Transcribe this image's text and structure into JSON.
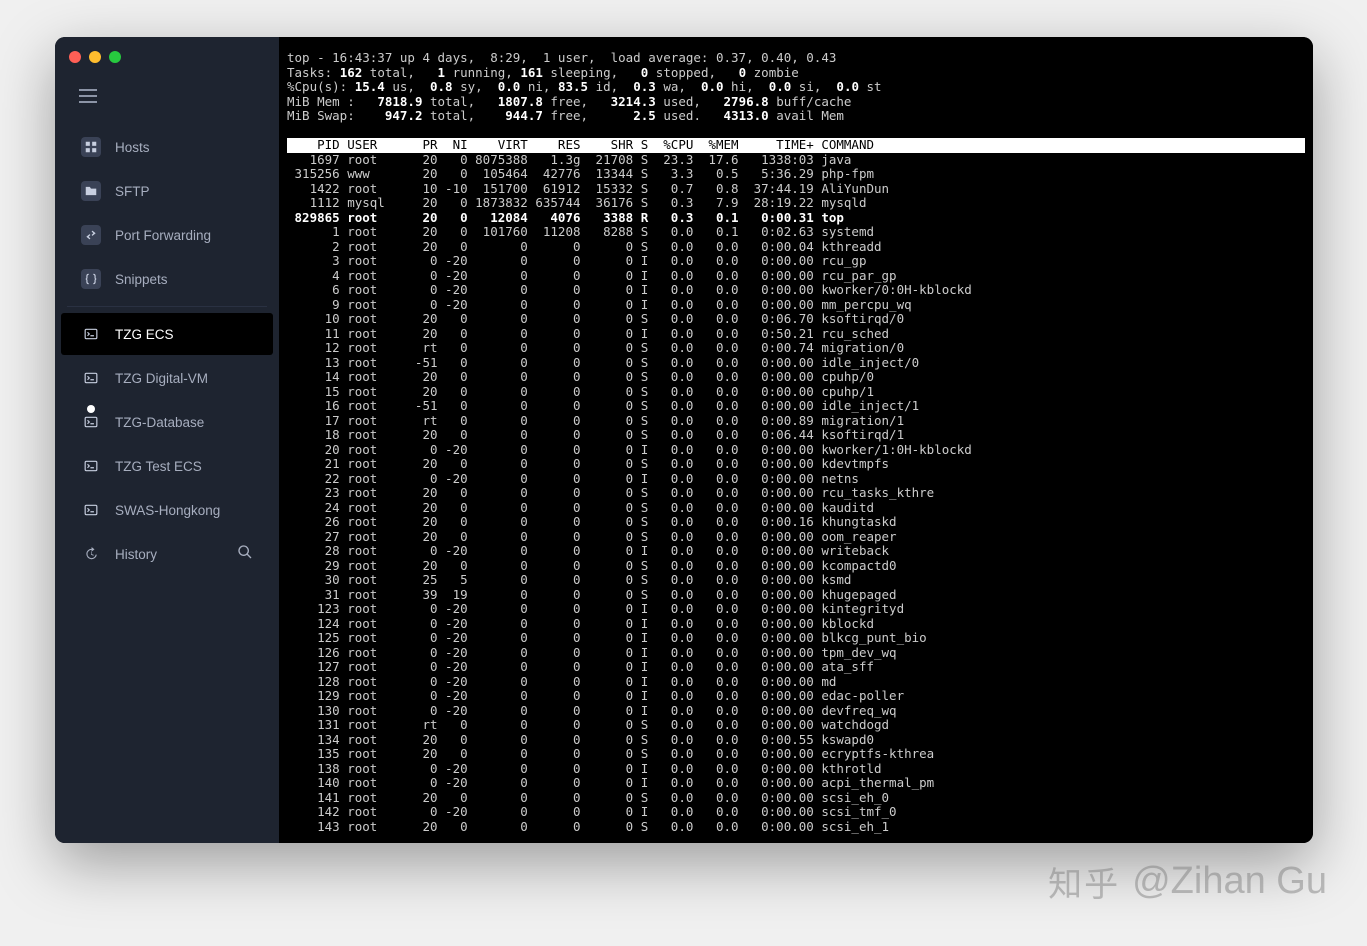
{
  "sidebar": {
    "items": [
      {
        "label": "Hosts",
        "icon": "grid"
      },
      {
        "label": "SFTP",
        "icon": "folder"
      },
      {
        "label": "Port Forwarding",
        "icon": "arrows"
      },
      {
        "label": "Snippets",
        "icon": "braces"
      },
      {
        "label": "TZG ECS",
        "icon": "term",
        "active": true
      },
      {
        "label": "TZG Digital-VM",
        "icon": "term"
      },
      {
        "label": "TZG-Database",
        "icon": "term",
        "dot": true
      },
      {
        "label": "TZG Test ECS",
        "icon": "term"
      },
      {
        "label": "SWAS-Hongkong",
        "icon": "term"
      }
    ],
    "history": "History"
  },
  "top": {
    "line1_a": "top - 16:43:37 up 4 days,  8:29,  1 user,  load average: 0.37, 0.40, 0.43",
    "tasks": {
      "total": "162",
      "running": "1",
      "sleeping": "161",
      "stopped": "0",
      "zombie": "0"
    },
    "cpu": {
      "us": "15.4",
      "sy": "0.8",
      "ni": "0.0",
      "id": "83.5",
      "wa": "0.3",
      "hi": "0.0",
      "si": "0.0",
      "st": "0.0"
    },
    "mem": {
      "total": "7818.9",
      "free": "1807.8",
      "used": "3214.3",
      "buff": "2796.8"
    },
    "swap": {
      "total": "947.2",
      "free": "944.7",
      "used": "2.5",
      "avail": "4313.0"
    },
    "header": "    PID USER      PR  NI    VIRT    RES    SHR S  %CPU  %MEM     TIME+ COMMAND",
    "rows": [
      [
        "   1697",
        "root",
        "20",
        "0",
        "8075388",
        "1.3g",
        "21708",
        "S",
        "23.3",
        "17.6",
        "1338:03",
        "java"
      ],
      [
        " 315256",
        "www",
        "20",
        "0",
        "105464",
        "42776",
        "13344",
        "S",
        "3.3",
        "0.5",
        "5:36.29",
        "php-fpm"
      ],
      [
        "   1422",
        "root",
        "10",
        "-10",
        "151700",
        "61912",
        "15332",
        "S",
        "0.7",
        "0.8",
        "37:44.19",
        "AliYunDun"
      ],
      [
        "   1112",
        "mysql",
        "20",
        "0",
        "1873832",
        "635744",
        "36176",
        "S",
        "0.3",
        "7.9",
        "28:19.22",
        "mysqld"
      ],
      [
        " 829865",
        "root",
        "20",
        "0",
        "12084",
        "4076",
        "3388",
        "R",
        "0.3",
        "0.1",
        "0:00.31",
        "top"
      ],
      [
        "      1",
        "root",
        "20",
        "0",
        "101760",
        "11208",
        "8288",
        "S",
        "0.0",
        "0.1",
        "0:02.63",
        "systemd"
      ],
      [
        "      2",
        "root",
        "20",
        "0",
        "0",
        "0",
        "0",
        "S",
        "0.0",
        "0.0",
        "0:00.04",
        "kthreadd"
      ],
      [
        "      3",
        "root",
        "0",
        "-20",
        "0",
        "0",
        "0",
        "I",
        "0.0",
        "0.0",
        "0:00.00",
        "rcu_gp"
      ],
      [
        "      4",
        "root",
        "0",
        "-20",
        "0",
        "0",
        "0",
        "I",
        "0.0",
        "0.0",
        "0:00.00",
        "rcu_par_gp"
      ],
      [
        "      6",
        "root",
        "0",
        "-20",
        "0",
        "0",
        "0",
        "I",
        "0.0",
        "0.0",
        "0:00.00",
        "kworker/0:0H-kblockd"
      ],
      [
        "      9",
        "root",
        "0",
        "-20",
        "0",
        "0",
        "0",
        "I",
        "0.0",
        "0.0",
        "0:00.00",
        "mm_percpu_wq"
      ],
      [
        "     10",
        "root",
        "20",
        "0",
        "0",
        "0",
        "0",
        "S",
        "0.0",
        "0.0",
        "0:06.70",
        "ksoftirqd/0"
      ],
      [
        "     11",
        "root",
        "20",
        "0",
        "0",
        "0",
        "0",
        "I",
        "0.0",
        "0.0",
        "0:50.21",
        "rcu_sched"
      ],
      [
        "     12",
        "root",
        "rt",
        "0",
        "0",
        "0",
        "0",
        "S",
        "0.0",
        "0.0",
        "0:00.74",
        "migration/0"
      ],
      [
        "     13",
        "root",
        "-51",
        "0",
        "0",
        "0",
        "0",
        "S",
        "0.0",
        "0.0",
        "0:00.00",
        "idle_inject/0"
      ],
      [
        "     14",
        "root",
        "20",
        "0",
        "0",
        "0",
        "0",
        "S",
        "0.0",
        "0.0",
        "0:00.00",
        "cpuhp/0"
      ],
      [
        "     15",
        "root",
        "20",
        "0",
        "0",
        "0",
        "0",
        "S",
        "0.0",
        "0.0",
        "0:00.00",
        "cpuhp/1"
      ],
      [
        "     16",
        "root",
        "-51",
        "0",
        "0",
        "0",
        "0",
        "S",
        "0.0",
        "0.0",
        "0:00.00",
        "idle_inject/1"
      ],
      [
        "     17",
        "root",
        "rt",
        "0",
        "0",
        "0",
        "0",
        "S",
        "0.0",
        "0.0",
        "0:00.89",
        "migration/1"
      ],
      [
        "     18",
        "root",
        "20",
        "0",
        "0",
        "0",
        "0",
        "S",
        "0.0",
        "0.0",
        "0:06.44",
        "ksoftirqd/1"
      ],
      [
        "     20",
        "root",
        "0",
        "-20",
        "0",
        "0",
        "0",
        "I",
        "0.0",
        "0.0",
        "0:00.00",
        "kworker/1:0H-kblockd"
      ],
      [
        "     21",
        "root",
        "20",
        "0",
        "0",
        "0",
        "0",
        "S",
        "0.0",
        "0.0",
        "0:00.00",
        "kdevtmpfs"
      ],
      [
        "     22",
        "root",
        "0",
        "-20",
        "0",
        "0",
        "0",
        "I",
        "0.0",
        "0.0",
        "0:00.00",
        "netns"
      ],
      [
        "     23",
        "root",
        "20",
        "0",
        "0",
        "0",
        "0",
        "S",
        "0.0",
        "0.0",
        "0:00.00",
        "rcu_tasks_kthre"
      ],
      [
        "     24",
        "root",
        "20",
        "0",
        "0",
        "0",
        "0",
        "S",
        "0.0",
        "0.0",
        "0:00.00",
        "kauditd"
      ],
      [
        "     26",
        "root",
        "20",
        "0",
        "0",
        "0",
        "0",
        "S",
        "0.0",
        "0.0",
        "0:00.16",
        "khungtaskd"
      ],
      [
        "     27",
        "root",
        "20",
        "0",
        "0",
        "0",
        "0",
        "S",
        "0.0",
        "0.0",
        "0:00.00",
        "oom_reaper"
      ],
      [
        "     28",
        "root",
        "0",
        "-20",
        "0",
        "0",
        "0",
        "I",
        "0.0",
        "0.0",
        "0:00.00",
        "writeback"
      ],
      [
        "     29",
        "root",
        "20",
        "0",
        "0",
        "0",
        "0",
        "S",
        "0.0",
        "0.0",
        "0:00.00",
        "kcompactd0"
      ],
      [
        "     30",
        "root",
        "25",
        "5",
        "0",
        "0",
        "0",
        "S",
        "0.0",
        "0.0",
        "0:00.00",
        "ksmd"
      ],
      [
        "     31",
        "root",
        "39",
        "19",
        "0",
        "0",
        "0",
        "S",
        "0.0",
        "0.0",
        "0:00.00",
        "khugepaged"
      ],
      [
        "    123",
        "root",
        "0",
        "-20",
        "0",
        "0",
        "0",
        "I",
        "0.0",
        "0.0",
        "0:00.00",
        "kintegrityd"
      ],
      [
        "    124",
        "root",
        "0",
        "-20",
        "0",
        "0",
        "0",
        "I",
        "0.0",
        "0.0",
        "0:00.00",
        "kblockd"
      ],
      [
        "    125",
        "root",
        "0",
        "-20",
        "0",
        "0",
        "0",
        "I",
        "0.0",
        "0.0",
        "0:00.00",
        "blkcg_punt_bio"
      ],
      [
        "    126",
        "root",
        "0",
        "-20",
        "0",
        "0",
        "0",
        "I",
        "0.0",
        "0.0",
        "0:00.00",
        "tpm_dev_wq"
      ],
      [
        "    127",
        "root",
        "0",
        "-20",
        "0",
        "0",
        "0",
        "I",
        "0.0",
        "0.0",
        "0:00.00",
        "ata_sff"
      ],
      [
        "    128",
        "root",
        "0",
        "-20",
        "0",
        "0",
        "0",
        "I",
        "0.0",
        "0.0",
        "0:00.00",
        "md"
      ],
      [
        "    129",
        "root",
        "0",
        "-20",
        "0",
        "0",
        "0",
        "I",
        "0.0",
        "0.0",
        "0:00.00",
        "edac-poller"
      ],
      [
        "    130",
        "root",
        "0",
        "-20",
        "0",
        "0",
        "0",
        "I",
        "0.0",
        "0.0",
        "0:00.00",
        "devfreq_wq"
      ],
      [
        "    131",
        "root",
        "rt",
        "0",
        "0",
        "0",
        "0",
        "S",
        "0.0",
        "0.0",
        "0:00.00",
        "watchdogd"
      ],
      [
        "    134",
        "root",
        "20",
        "0",
        "0",
        "0",
        "0",
        "S",
        "0.0",
        "0.0",
        "0:00.55",
        "kswapd0"
      ],
      [
        "    135",
        "root",
        "20",
        "0",
        "0",
        "0",
        "0",
        "S",
        "0.0",
        "0.0",
        "0:00.00",
        "ecryptfs-kthrea"
      ],
      [
        "    138",
        "root",
        "0",
        "-20",
        "0",
        "0",
        "0",
        "I",
        "0.0",
        "0.0",
        "0:00.00",
        "kthrotld"
      ],
      [
        "    140",
        "root",
        "0",
        "-20",
        "0",
        "0",
        "0",
        "I",
        "0.0",
        "0.0",
        "0:00.00",
        "acpi_thermal_pm"
      ],
      [
        "    141",
        "root",
        "20",
        "0",
        "0",
        "0",
        "0",
        "S",
        "0.0",
        "0.0",
        "0:00.00",
        "scsi_eh_0"
      ],
      [
        "    142",
        "root",
        "0",
        "-20",
        "0",
        "0",
        "0",
        "I",
        "0.0",
        "0.0",
        "0:00.00",
        "scsi_tmf_0"
      ],
      [
        "    143",
        "root",
        "20",
        "0",
        "0",
        "0",
        "0",
        "S",
        "0.0",
        "0.0",
        "0:00.00",
        "scsi_eh_1"
      ]
    ],
    "bold_row_index": 4
  },
  "watermark": {
    "zh": "知乎",
    "at": "@Zihan Gu"
  }
}
